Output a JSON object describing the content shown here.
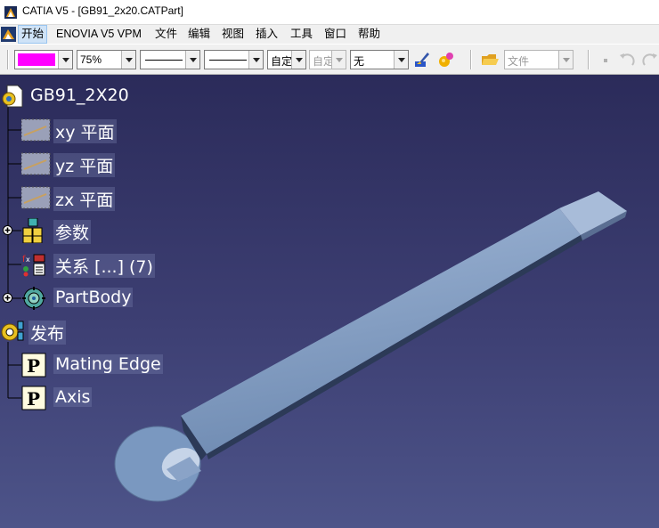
{
  "window": {
    "title": "CATIA V5 - [GB91_2x20.CATPart]"
  },
  "menu": {
    "items": [
      "开始",
      "ENOVIA V5 VPM",
      "文件",
      "编辑",
      "视图",
      "插入",
      "工具",
      "窗口",
      "帮助"
    ]
  },
  "toolbar": {
    "color_swatch": "#ff00ff",
    "transparency": "75%",
    "linetype_combo": "",
    "thickness_combo": "",
    "layer_auto": "自定",
    "layer_auto_disabled": "自定",
    "layer_value": "无",
    "file_combo": "文件"
  },
  "tree": {
    "root": "GB91_2X20",
    "items": [
      {
        "label": "xy 平面"
      },
      {
        "label": "yz 平面"
      },
      {
        "label": "zx 平面"
      },
      {
        "label": "参数"
      },
      {
        "label": "关系 [...] (7)"
      },
      {
        "label": "PartBody"
      }
    ],
    "publication": {
      "label": "发布",
      "children": [
        {
          "label": "Mating Edge"
        },
        {
          "label": "Axis"
        }
      ]
    }
  },
  "colors": {
    "viewport_top": "#2b2b5a",
    "viewport_bottom": "#4d5489",
    "part": "#7d9ac0",
    "swatch": "#ff00ff"
  }
}
